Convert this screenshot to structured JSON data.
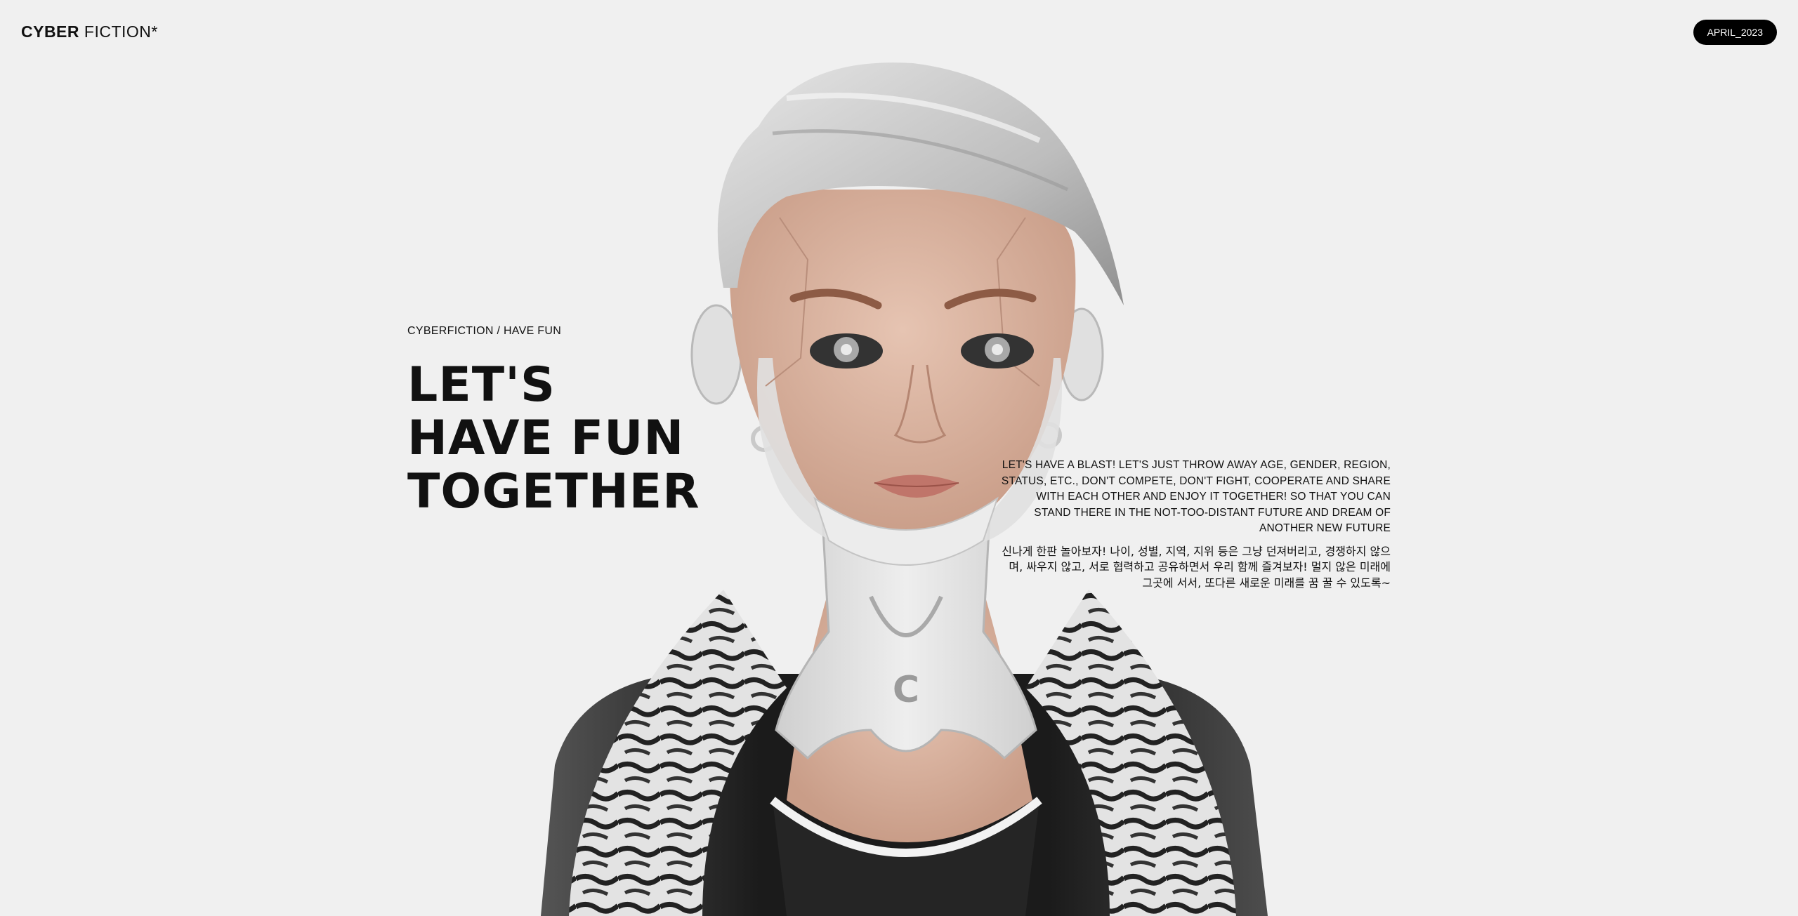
{
  "header": {
    "logo_bold": "CYBER",
    "logo_light": "FICTION*",
    "date_badge": "APRIL_2023"
  },
  "hero": {
    "eyebrow": "CYBERFICTION / HAVE FUN",
    "headline": [
      "LET'S",
      "HAVE FUN",
      "TOGETHER"
    ],
    "description_en": "LET'S HAVE A BLAST! LET'S JUST THROW AWAY AGE, GENDER, REGION, STATUS, ETC., DON'T COMPETE, DON'T FIGHT, COOPERATE AND SHARE WITH EACH OTHER AND ENJOY IT TOGETHER! SO THAT YOU CAN STAND THERE IN THE NOT-TOO-DISTANT FUTURE AND DREAM OF ANOTHER NEW FUTURE",
    "description_ko": "신나게 한판 놀아보자! 나이, 성별, 지역, 지위 등은 그냥 던져버리고, 경쟁하지 않으며, 싸우지 않고, 서로 협력하고 공유하면서 우리 함께 즐겨보자! 멀지 않은 미래에 그곳에 서서, 또다른 새로운 미래를 꿈 꿀 수 있도록~"
  },
  "figure": {
    "neck_brace_letter": "C",
    "colors": {
      "background": "#f0f0f0",
      "hair": "#c9c9c9",
      "skin": "#dcb8a6",
      "cyber_plate": "#e2e2e2",
      "lips": "#c0756a",
      "jacket": "#1e1e1e",
      "fur": "#dddddd"
    }
  }
}
